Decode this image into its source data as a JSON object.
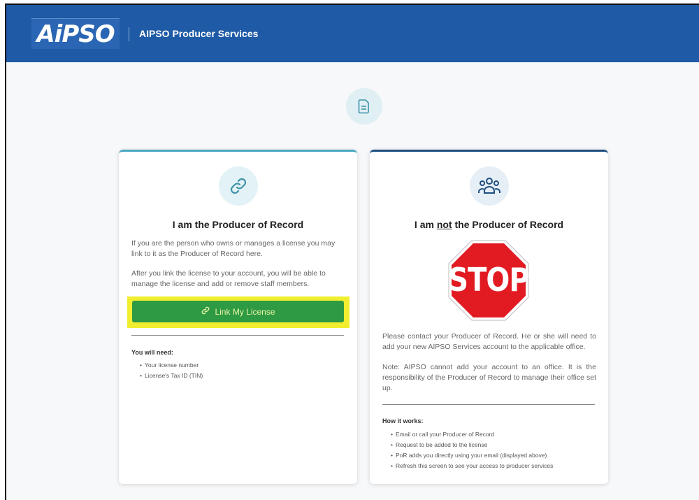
{
  "header": {
    "logo_text": "AiPSO",
    "title": "AIPSO Producer Services"
  },
  "page_icon": "document-icon",
  "left_card": {
    "icon": "link-icon",
    "title": "I am the Producer of Record",
    "para1": "If you are the person who owns or manages a license you may link to it as the Producer of Record here.",
    "para2": "After you link the license to your account, you will be able to manage the license and add or remove staff members.",
    "button_label": "Link My License",
    "needs_title": "You will need:",
    "needs": [
      "Your license number",
      "License's Tax ID (TIN)"
    ]
  },
  "right_card": {
    "icon": "people-group-icon",
    "title_before": "I am ",
    "title_emphasis": "not",
    "title_after": " the Producer of Record",
    "stop_sign_text": "STOP",
    "para1": "Please contact your Producer of Record. He or she will need to add your new AIPSO Services account to the applicable office.",
    "para2": "Note: AIPSO cannot add your account to an office. It is the responsibility of the Producer of Record to manage their office set up.",
    "how_title": "How it works:",
    "steps": [
      "Email or call your Producer of Record",
      "Request to be added to the license",
      "PoR adds you directly using your email (displayed above)",
      "Refresh this screen to see your access to producer services"
    ]
  },
  "colors": {
    "header_blue": "#1f5aa6",
    "button_green": "#2e9a43",
    "highlight_yellow": "#f1ee2f",
    "stop_red": "#e21b23",
    "left_accent": "#4aa7bf",
    "right_accent": "#1f4e7f"
  }
}
